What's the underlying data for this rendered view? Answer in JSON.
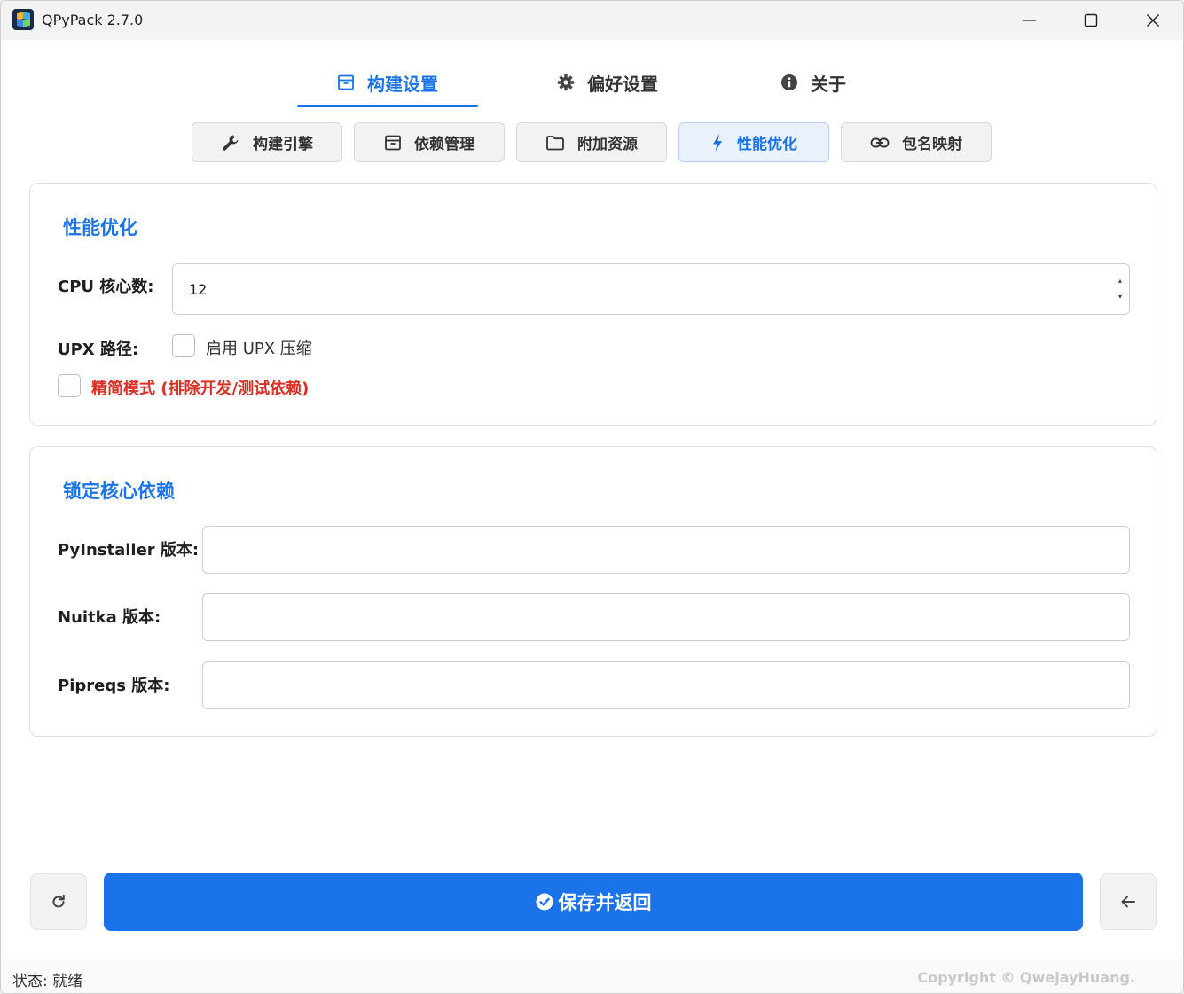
{
  "window": {
    "title": "QPyPack 2.7.0"
  },
  "main_tabs": [
    {
      "label": "构建设置",
      "icon": "archive-icon",
      "active": true
    },
    {
      "label": "偏好设置",
      "icon": "gear-icon",
      "active": false
    },
    {
      "label": "关于",
      "icon": "info-icon",
      "active": false
    }
  ],
  "sub_tabs": [
    {
      "label": "构建引擎",
      "icon": "wrench-icon",
      "active": false
    },
    {
      "label": "依赖管理",
      "icon": "archive-icon",
      "active": false
    },
    {
      "label": "附加资源",
      "icon": "folder-icon",
      "active": false
    },
    {
      "label": "性能优化",
      "icon": "bolt-icon",
      "active": true
    },
    {
      "label": "包名映射",
      "icon": "link-icon",
      "active": false
    }
  ],
  "perf": {
    "title": "性能优化",
    "cpu_label": "CPU 核心数:",
    "cpu_value": "12",
    "upx_label": "UPX 路径:",
    "upx_checkbox_label": "启用 UPX 压缩",
    "upx_checked": false,
    "slim_label": "精简模式 (排除开发/测试依赖)",
    "slim_checked": false
  },
  "lock": {
    "title": "锁定核心依赖",
    "pyinstaller_label": "PyInstaller 版本:",
    "pyinstaller_value": "",
    "nuitka_label": "Nuitka 版本:",
    "nuitka_value": "",
    "pipreqs_label": "Pipreqs 版本:",
    "pipreqs_value": ""
  },
  "actions": {
    "save_label": "保存并返回"
  },
  "status": {
    "text": "状态: 就绪",
    "copyright": "Copyright © QwejayHuang."
  },
  "colors": {
    "accent": "#1a73e8",
    "warning_text": "#d93025"
  }
}
